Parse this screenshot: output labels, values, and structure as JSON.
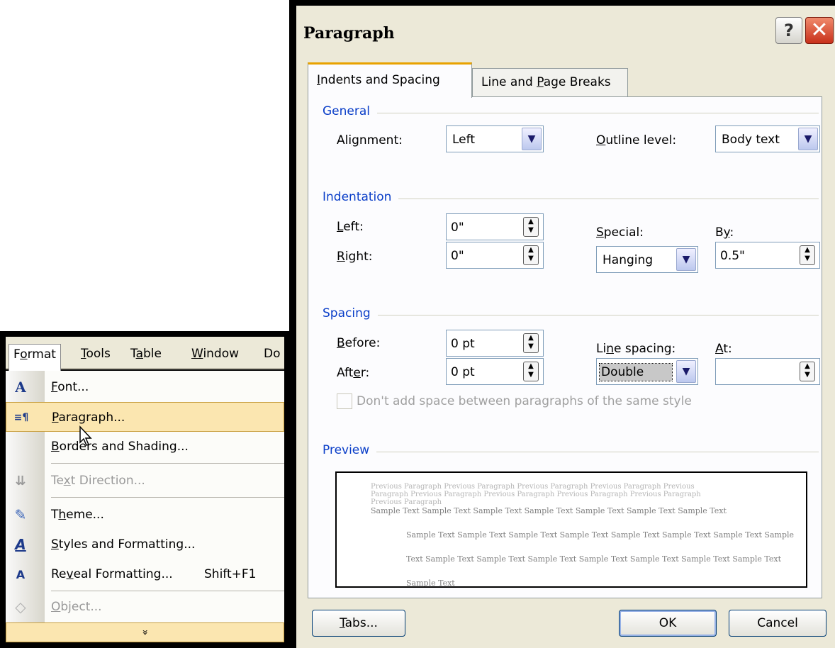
{
  "menu": {
    "bar": [
      {
        "label": "Format",
        "accel": "o"
      },
      {
        "label": "Tools",
        "accel": "T"
      },
      {
        "label": "Table",
        "accel": "a"
      },
      {
        "label": "Window",
        "accel": "W"
      },
      {
        "label": "Do"
      }
    ],
    "items": [
      {
        "label": "Font...",
        "accel": "F",
        "icon": "font-icon",
        "glyph": "A"
      },
      {
        "label": "Paragraph...",
        "accel": "P",
        "icon": "paragraph-icon",
        "glyph": "≡¶"
      },
      {
        "label": "Borders and Shading...",
        "accel": "B",
        "icon": "borders-icon",
        "glyph": ""
      },
      {
        "label": "Text Direction...",
        "accel": "x",
        "icon": "text-direction-icon",
        "glyph": "⇊"
      },
      {
        "label": "Theme...",
        "accel": "h",
        "icon": "theme-icon",
        "glyph": "✎"
      },
      {
        "label": "Styles and Formatting...",
        "accel": "S",
        "icon": "styles-icon",
        "glyph": "A"
      },
      {
        "label": "Reveal Formatting...",
        "accel": "v",
        "shortcut": "Shift+F1",
        "icon": "reveal-formatting-icon",
        "glyph": "A"
      },
      {
        "label": "Object...",
        "accel": "O",
        "icon": "object-icon",
        "glyph": "◇"
      }
    ],
    "more_glyph": "»"
  },
  "dialog": {
    "title": "Paragraph",
    "help": "?",
    "close": "✕",
    "tabs": [
      {
        "label": "Indents and Spacing",
        "accel": "I"
      },
      {
        "label": "Line and Page Breaks",
        "accel": "P"
      }
    ],
    "general": {
      "heading": "General",
      "alignment_label": "Alignment:",
      "alignment": "Left",
      "outline_label": "Outline level:",
      "outline": "Body text"
    },
    "indentation": {
      "heading": "Indentation",
      "left_label": "Left:",
      "left": "0\"",
      "right_label": "Right:",
      "right": "0\"",
      "special_label": "Special:",
      "special": "Hanging",
      "by_label": "By:",
      "by": "0.5\""
    },
    "spacing": {
      "heading": "Spacing",
      "before_label": "Before:",
      "before": "0 pt",
      "after_label": "After:",
      "after": "0 pt",
      "line_spacing_label": "Line spacing:",
      "line_spacing": "Double",
      "at_label": "At:",
      "at": "",
      "dont_add_label": "Don't add space between paragraphs of the same style",
      "dont_add_checked": false
    },
    "preview": {
      "heading": "Preview",
      "prev_lines": [
        "Previous Paragraph Previous Paragraph Previous Paragraph Previous Paragraph Previous",
        "Paragraph Previous Paragraph Previous Paragraph Previous Paragraph Previous Paragraph",
        "Previous Paragraph"
      ],
      "sample_lines": [
        "Sample Text Sample Text Sample Text Sample Text Sample Text Sample Text Sample Text",
        "Sample Text Sample Text Sample Text Sample Text Sample Text Sample Text Sample Text Sample",
        "Text Sample Text Sample Text Sample Text Sample Text Sample Text Sample Text Sample Text",
        "Sample Text"
      ]
    },
    "buttons": {
      "tabs": "Tabs...",
      "ok": "OK",
      "cancel": "Cancel"
    }
  }
}
